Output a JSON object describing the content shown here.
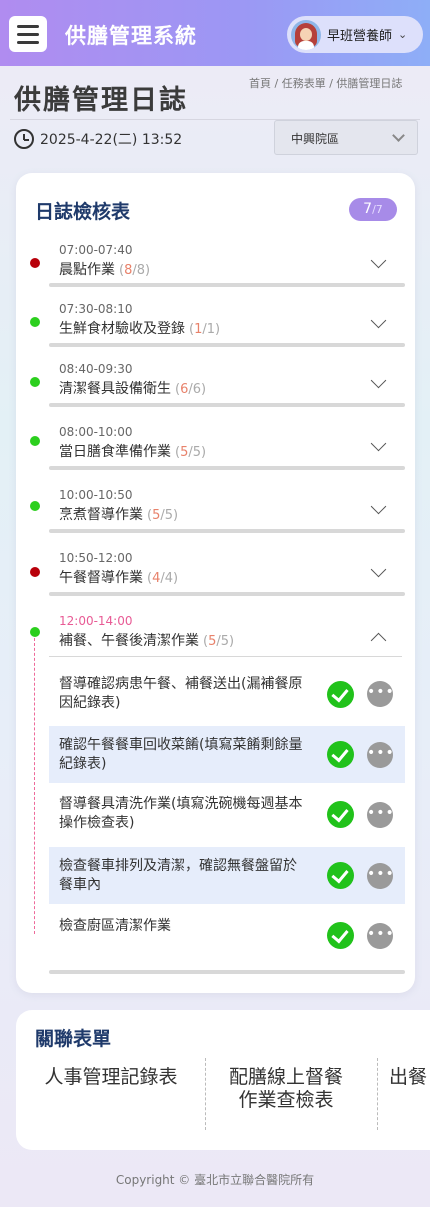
{
  "header": {
    "app_title": "供膳管理系統",
    "user_name": "早班營養師",
    "menu_icon": "hamburger-menu-icon",
    "caret_icon": "chevron-down-icon"
  },
  "page": {
    "title": "供膳管理日誌",
    "breadcrumb": "首頁 / 任務表單 / 供膳管理日誌",
    "datetime": "2025-4-22(二) 13:52",
    "hospital_select": "中興院區"
  },
  "checklist": {
    "title": "日誌檢核表",
    "badge_done": "7",
    "badge_total": "/7",
    "tasks": [
      {
        "time": "07:00-07:40",
        "name": "晨點作業",
        "done": "8",
        "total": "/8",
        "status": "red"
      },
      {
        "time": "07:30-08:10",
        "name": "生鮮食材驗收及登錄",
        "done": "1",
        "total": "/1",
        "status": "green"
      },
      {
        "time": "08:40-09:30",
        "name": "清潔餐具設備衛生",
        "done": "6",
        "total": "/6",
        "status": "green"
      },
      {
        "time": "08:00-10:00",
        "name": "當日膳食準備作業",
        "done": "5",
        "total": "/5",
        "status": "green"
      },
      {
        "time": "10:00-10:50",
        "name": "烹煮督導作業",
        "done": "5",
        "total": "/5",
        "status": "green"
      },
      {
        "time": "10:50-12:00",
        "name": "午餐督導作業",
        "done": "4",
        "total": "/4",
        "status": "red"
      },
      {
        "time": "12:00-14:00",
        "name": "補餐、午餐後清潔作業",
        "done": "5",
        "total": "/5",
        "status": "green",
        "expanded": true
      }
    ],
    "subitems": [
      "督導確認病患午餐、補餐送出(漏補餐原因紀錄表)",
      "確認午餐餐車回收菜餚(填寫菜餚剩餘量紀錄表)",
      "督導餐具清洗作業(填寫洗碗機每週基本操作檢查表)",
      "檢查餐車排列及清潔，確認無餐盤留於餐車內",
      "檢查廚區清潔作業"
    ],
    "more_label": "•••"
  },
  "related": {
    "title": "關聯表單",
    "items": [
      "人事管理記錄表",
      "配膳線上督餐作業查檢表",
      "出餐"
    ]
  },
  "footer": {
    "copyright": "Copyright © 臺北市立聯合醫院所有"
  }
}
